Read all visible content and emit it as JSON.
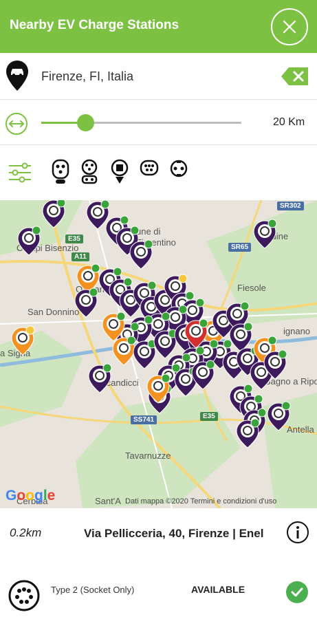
{
  "header": {
    "title": "Nearby EV Charge Stations",
    "close_icon": "close-icon"
  },
  "search": {
    "location": "Firenze, FI, Italia"
  },
  "radius": {
    "value_label": "20 Km",
    "fraction": 0.22
  },
  "filters": {
    "connector_icons": [
      "type1-plug-icon",
      "combo-plug-icon",
      "chademo-plug-icon",
      "type2-plug-icon",
      "schuko-plug-icon"
    ]
  },
  "map": {
    "labels": [
      "Campi Bisenzio",
      "San Donnino",
      "a Signa",
      "Scandicci",
      "Fiesole",
      "Caldine",
      "Tavarnuzze",
      "Bagno a Ripoli",
      "Antella",
      "une di",
      "Fiorentino",
      "Osmannoro",
      "Cerbaia",
      "Sant'A",
      "ignano"
    ],
    "roads": [
      "E35",
      "A11",
      "SR65",
      "SR302",
      "SS741",
      "E35"
    ],
    "google": "Google",
    "attribution": "Dati mappa ©2020   Termini e condizioni d'uso",
    "colors": {
      "purple": "#3d1a5c",
      "orange": "#f39221",
      "green_dot": "#3aa33a",
      "yellow_dot": "#f5c83a",
      "red_center": "#d32f2f"
    }
  },
  "station": {
    "distance": "0.2km",
    "address": "Via Pellicceria, 40, Firenze | Enel",
    "connector_type": "Type 2 (Socket Only)",
    "status": "AVAILABLE"
  },
  "colors": {
    "accent": "#7cc142",
    "status_ok": "#4caf50"
  }
}
